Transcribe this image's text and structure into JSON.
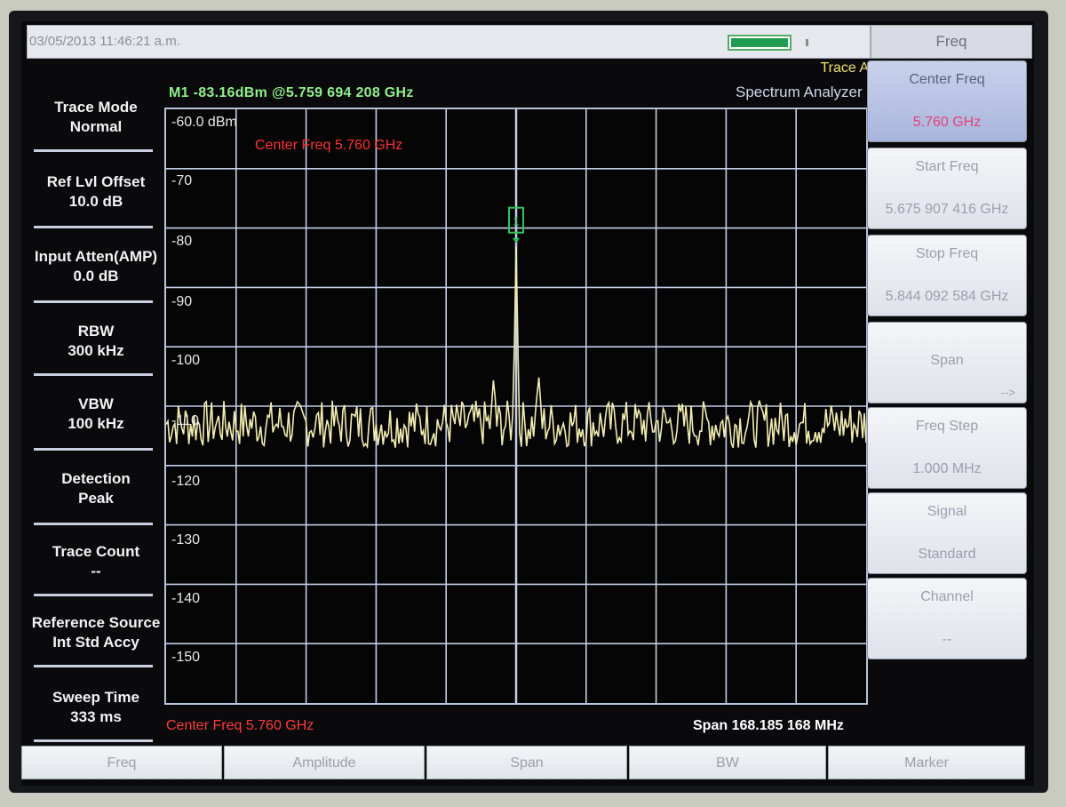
{
  "status": {
    "datetime": "03/05/2013 11:46:21 a.m.",
    "battery_level": 0.9
  },
  "header": {
    "trace": "Trace A",
    "mode": "Spectrum Analyzer"
  },
  "marker": {
    "readout": "M1 -83.16dBm @5.759 694 208 GHz",
    "label": "1"
  },
  "params": [
    {
      "name": "Trace Mode",
      "value": "Normal"
    },
    {
      "name": "Ref Lvl Offset",
      "value": "10.0 dB"
    },
    {
      "name": "Input Atten(AMP)",
      "value": "0.0 dB"
    },
    {
      "name": "RBW",
      "value": "300 kHz"
    },
    {
      "name": "VBW",
      "value": "100 kHz"
    },
    {
      "name": "Detection",
      "value": "Peak"
    },
    {
      "name": "Trace Count",
      "value": "--"
    },
    {
      "name": "Reference Source",
      "value": "Int Std Accy"
    },
    {
      "name": "Sweep Time",
      "value": "333 ms"
    }
  ],
  "plot": {
    "ref_label": "-60.0 dBm",
    "y_ticks": [
      "-70",
      "-80",
      "-90",
      "-100",
      "-110",
      "-120",
      "-130",
      "-140",
      "-150"
    ],
    "center_label": "Center Freq 5.760 GHz"
  },
  "footer": {
    "center": "Center Freq 5.760 GHz",
    "span": "Span 168.185 168 MHz"
  },
  "softkeys": {
    "header": "Freq",
    "items": [
      {
        "label": "Center Freq",
        "value": "5.760 GHz",
        "active": true
      },
      {
        "label": "Start Freq",
        "value": "5.675 907 416 GHz"
      },
      {
        "label": "Stop Freq",
        "value": "5.844 092 584 GHz"
      },
      {
        "label": "Span",
        "value": "",
        "arrow": "-->"
      },
      {
        "label": "Freq Step",
        "value": "1.000 MHz"
      },
      {
        "label": "Signal",
        "value": "Standard"
      },
      {
        "label": "Channel",
        "value": "--"
      }
    ]
  },
  "tabs": [
    "Freq",
    "Amplitude",
    "Span",
    "BW",
    "Marker"
  ],
  "colors": {
    "trace": "#f2ecb0",
    "grid": "#c3cde6",
    "marker": "#2ec45a",
    "center_text": "#ff3030"
  },
  "chart_data": {
    "type": "line",
    "xlabel": "",
    "ylabel": "",
    "x_center_ghz": 5.76,
    "x_span_mhz": 168.185168,
    "ylim": [
      -160,
      -60
    ],
    "grid": true,
    "noise_floor_dbm": -113,
    "peaks": [
      {
        "x_offset_mhz": 0,
        "dbm": -83.16
      },
      {
        "x_offset_mhz": -5.4,
        "dbm": -105
      },
      {
        "x_offset_mhz": 5.4,
        "dbm": -104.5
      }
    ]
  }
}
